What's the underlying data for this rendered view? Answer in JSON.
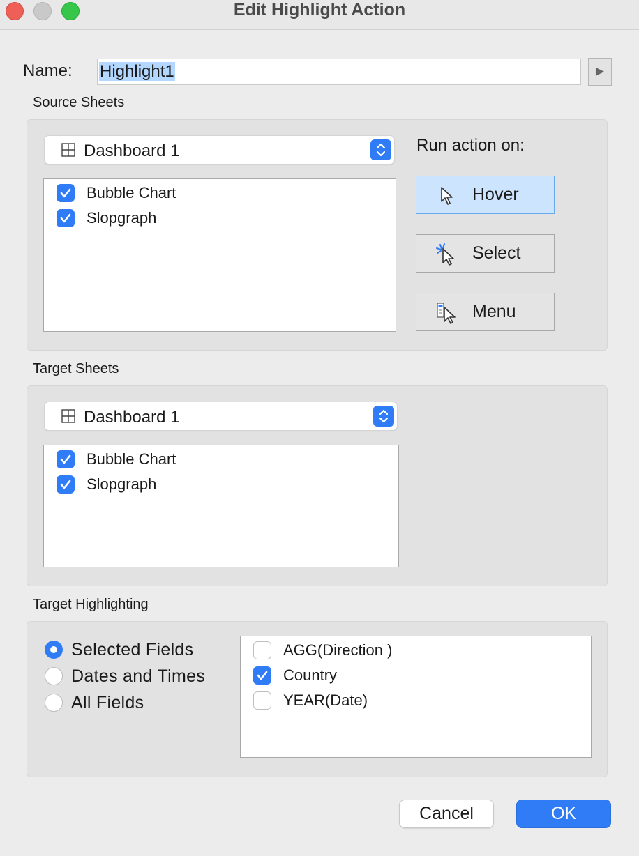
{
  "window": {
    "title": "Edit Highlight Action"
  },
  "name_field": {
    "label": "Name:",
    "value": "Highlight1"
  },
  "source": {
    "section_label": "Source Sheets",
    "dropdown_value": "Dashboard 1",
    "sheets": [
      {
        "label": "Bubble Chart",
        "checked": true
      },
      {
        "label": "Slopgraph",
        "checked": true
      }
    ],
    "run_action_label": "Run action on:",
    "actions": {
      "hover": "Hover",
      "select": "Select",
      "menu": "Menu",
      "selected": "Hover"
    }
  },
  "target": {
    "section_label": "Target Sheets",
    "dropdown_value": "Dashboard 1",
    "sheets": [
      {
        "label": "Bubble Chart",
        "checked": true
      },
      {
        "label": "Slopgraph",
        "checked": true
      }
    ]
  },
  "highlighting": {
    "section_label": "Target Highlighting",
    "options": [
      {
        "label": "Selected Fields",
        "selected": true
      },
      {
        "label": "Dates and Times",
        "selected": false
      },
      {
        "label": "All Fields",
        "selected": false
      }
    ],
    "fields": [
      {
        "label": "AGG(Direction )",
        "checked": false
      },
      {
        "label": "Country",
        "checked": true
      },
      {
        "label": "YEAR(Date)",
        "checked": false
      }
    ]
  },
  "footer": {
    "cancel": "Cancel",
    "ok": "OK"
  },
  "colors": {
    "accent": "#2f7cf6",
    "selection": "#b3d7ff",
    "active_button": "#cce4fd"
  }
}
